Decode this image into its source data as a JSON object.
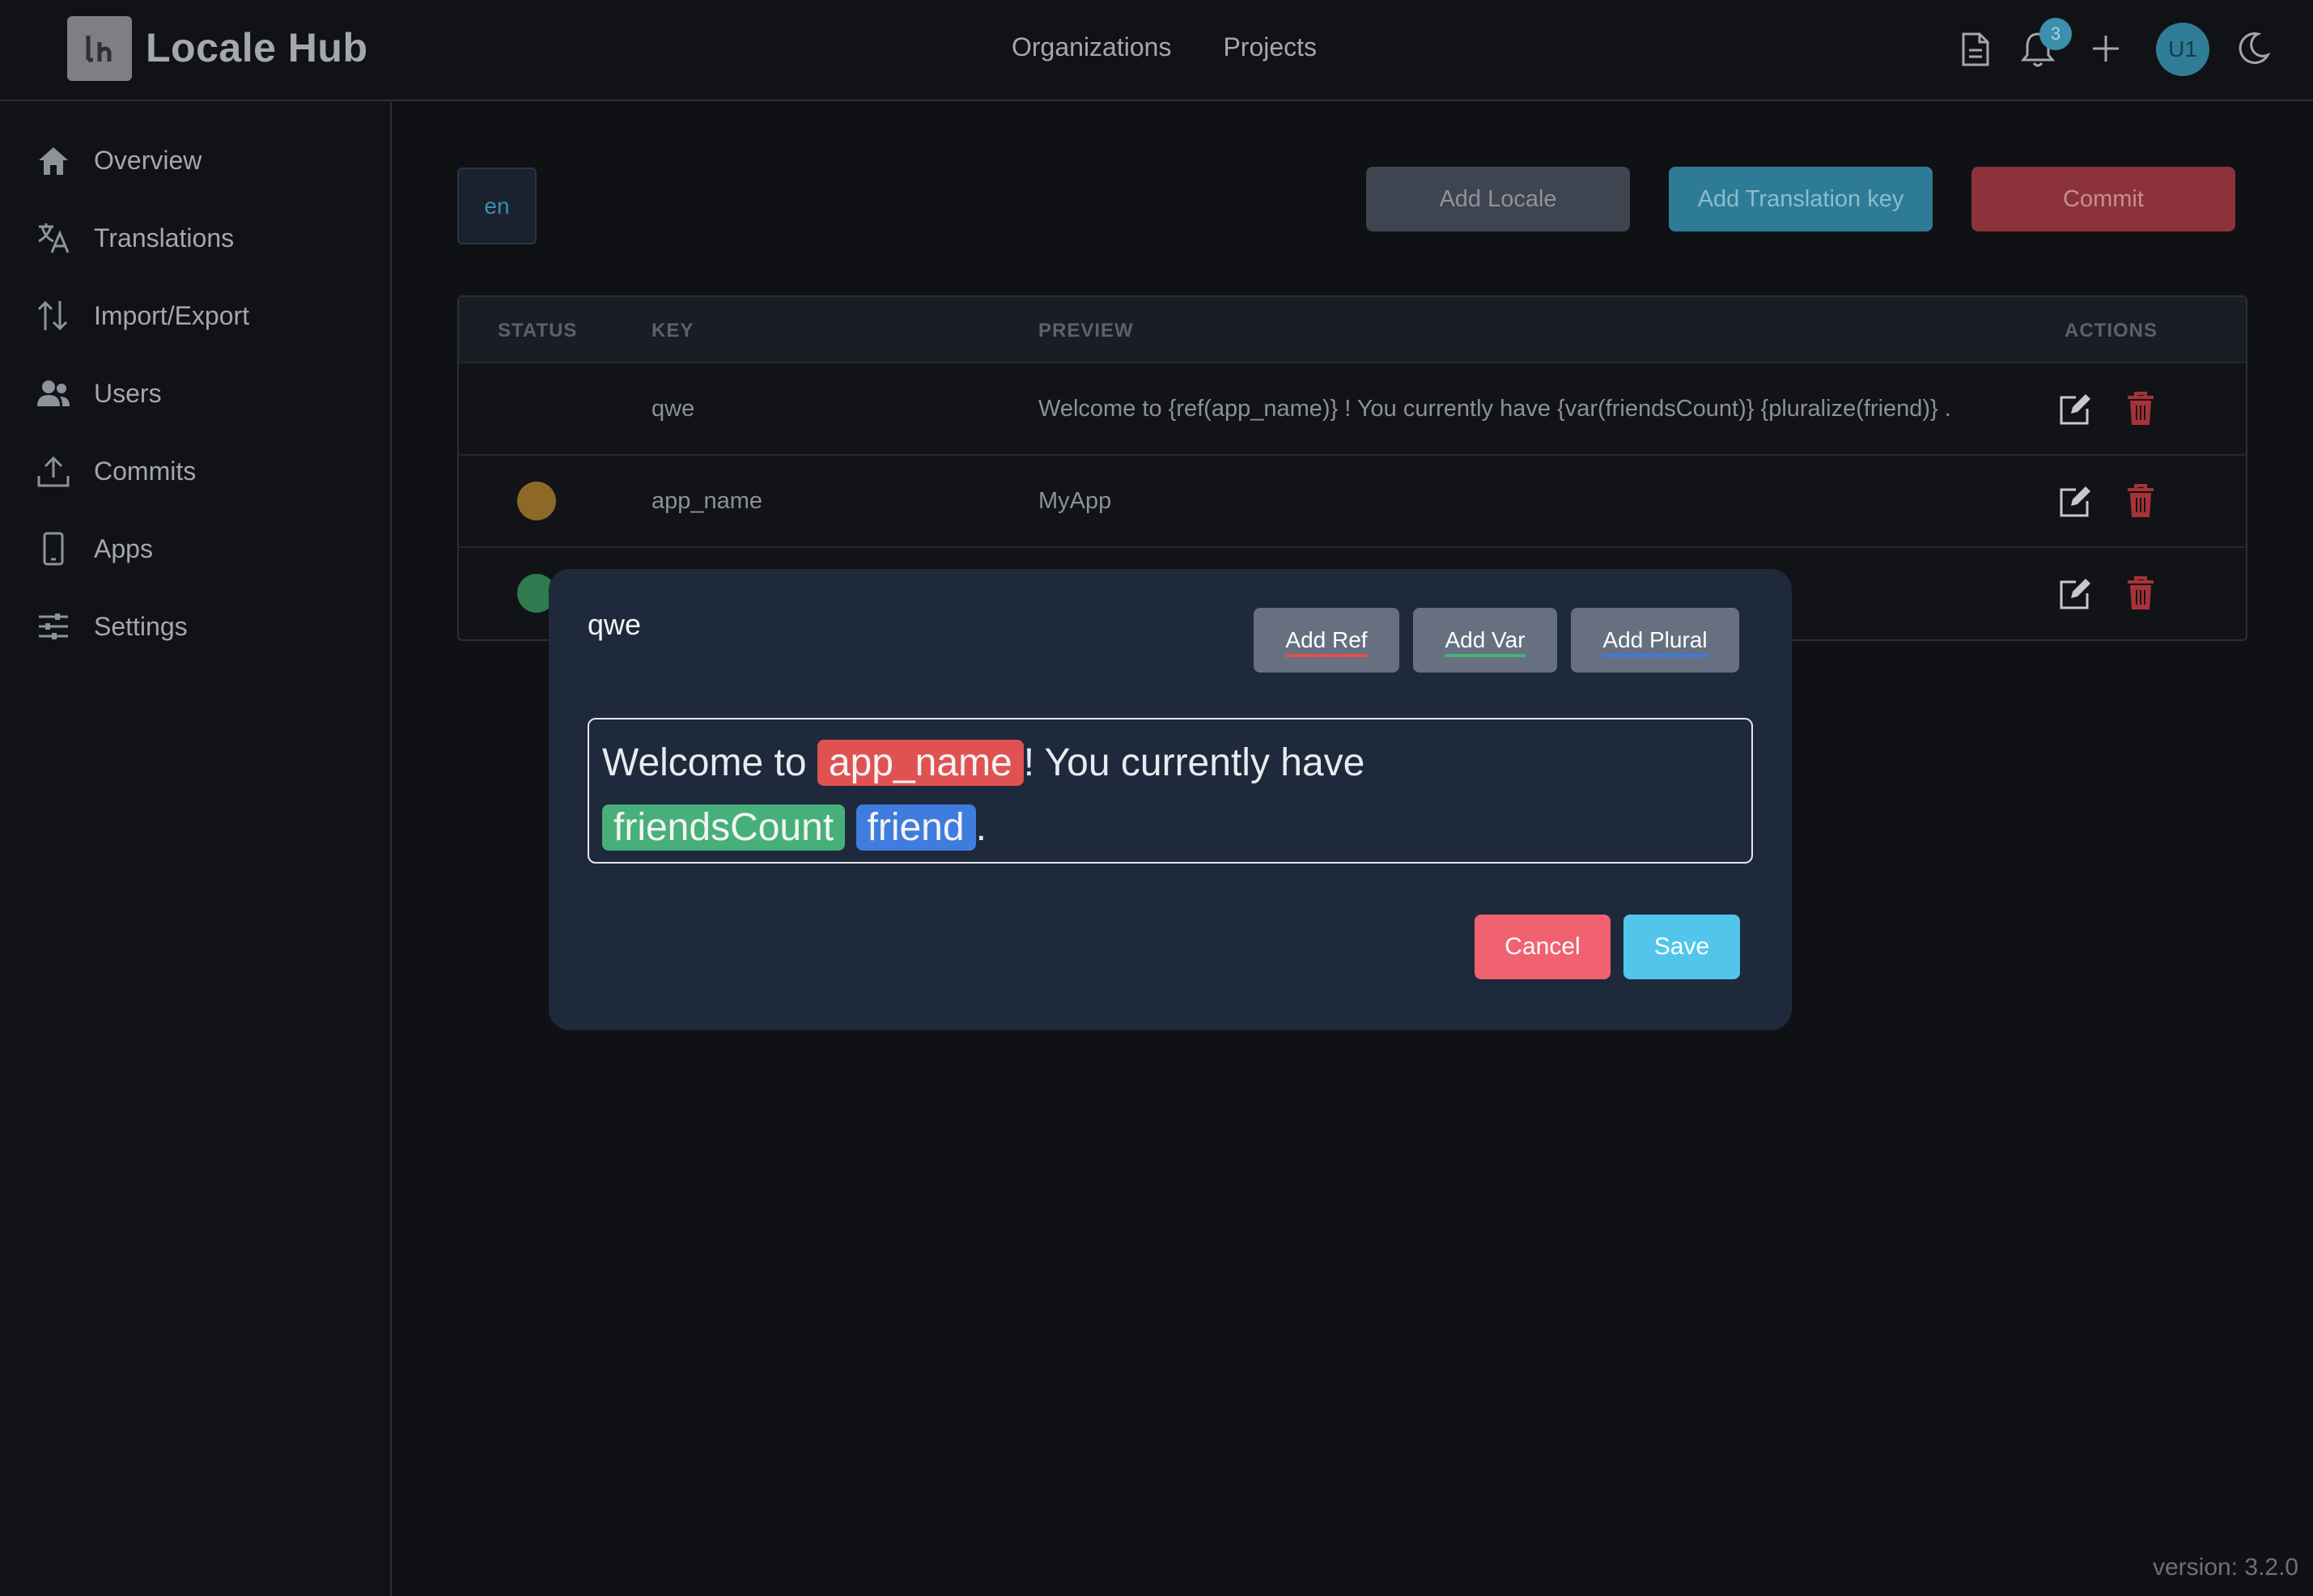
{
  "header": {
    "app_title": "Locale Hub",
    "nav": [
      "Organizations",
      "Projects"
    ],
    "notification_count": "3",
    "avatar_initials": "U1"
  },
  "sidebar": {
    "items": [
      {
        "label": "Overview",
        "icon": "home-icon"
      },
      {
        "label": "Translations",
        "icon": "translate-icon"
      },
      {
        "label": "Import/Export",
        "icon": "import-export-icon"
      },
      {
        "label": "Users",
        "icon": "users-icon"
      },
      {
        "label": "Commits",
        "icon": "upload-icon"
      },
      {
        "label": "Apps",
        "icon": "phone-icon"
      },
      {
        "label": "Settings",
        "icon": "sliders-icon"
      }
    ]
  },
  "toolbar": {
    "locale": "en",
    "add_locale": "Add Locale",
    "add_translation_key": "Add Translation key",
    "commit": "Commit"
  },
  "table": {
    "columns": [
      "STATUS",
      "KEY",
      "PREVIEW",
      "ACTIONS"
    ],
    "rows": [
      {
        "status": "",
        "key": "qwe",
        "preview": "Welcome to {ref(app_name)} ! You currently have {var(friendsCount)}   {pluralize(friend)} ."
      },
      {
        "status": "#8c6a26",
        "key": "app_name",
        "preview": "MyApp"
      },
      {
        "status": "#2f7a4e",
        "key": "",
        "preview": ""
      }
    ]
  },
  "modal": {
    "title": "qwe",
    "add_ref": "Add Ref",
    "add_var": "Add Var",
    "add_plural": "Add Plural",
    "editor": {
      "text1": "Welcome to",
      "ref_token": "app_name",
      "text2": "! You currently have",
      "var_token": "friendsCount",
      "plural_token": "friend",
      "text3": "."
    },
    "cancel": "Cancel",
    "save": "Save"
  },
  "footer": {
    "version": "version: 3.2.0"
  },
  "colors": {
    "ref": "#e05252",
    "var": "#47b07a",
    "plural": "#3f7ce0",
    "delete": "#a8323a"
  }
}
